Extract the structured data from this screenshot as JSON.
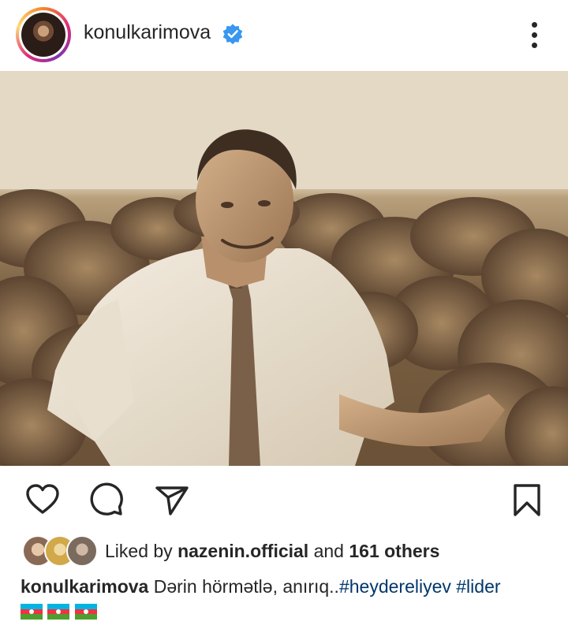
{
  "post": {
    "username": "konulkarimova",
    "verified_icon": "verified-badge-icon",
    "more_icon": "more-vertical-icon",
    "photo_description_icon": "sepia-portrait-photo"
  },
  "actions": {
    "like_icon": "heart-icon",
    "comment_icon": "comment-icon",
    "share_icon": "send-icon",
    "save_icon": "bookmark-icon"
  },
  "likes": {
    "prefix": "Liked by",
    "user": "nazenin.official",
    "and": "and",
    "others": "161 others"
  },
  "caption": {
    "username": "konulkarimova",
    "text": "Dərin hörmətlə, anırıq..",
    "hashtag1": "#heydereliyev",
    "hashtag2": "#lider",
    "flags": "🇦🇿🇦🇿🇦🇿"
  },
  "colors": {
    "text": "#262626",
    "verified": "#3897f0",
    "hashtag": "#00376b"
  }
}
